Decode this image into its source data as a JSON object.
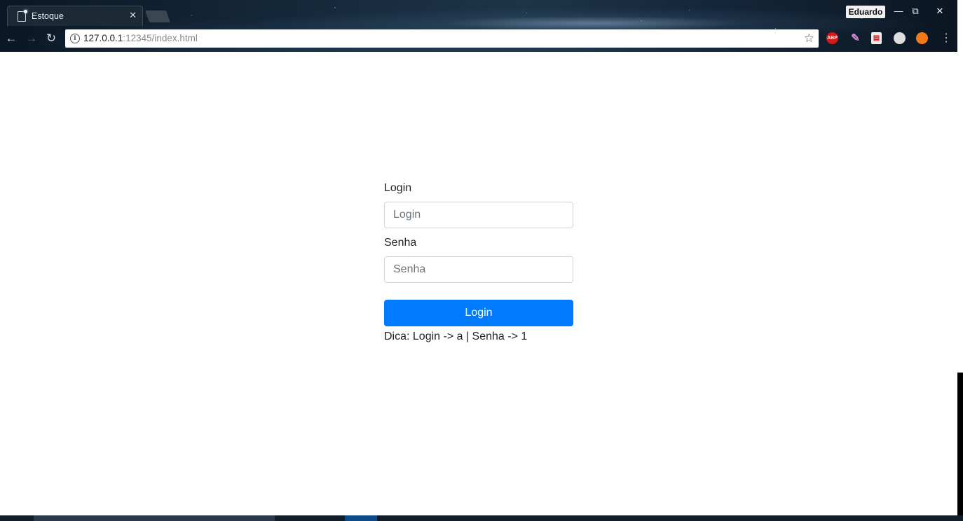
{
  "browser": {
    "tab": {
      "title": "Estoque",
      "close_glyph": "✕"
    },
    "profile_name": "Eduardo",
    "window_controls": {
      "minimize": "—",
      "maximize": "⧉",
      "close": "✕"
    },
    "nav": {
      "back": "←",
      "forward": "→",
      "reload": "↻"
    },
    "address": {
      "host": "127.0.0.1",
      "rest": ":12345/index.html"
    },
    "extensions": {
      "abp_label": "ABP"
    }
  },
  "form": {
    "login_label": "Login",
    "login_placeholder": "Login",
    "password_label": "Senha",
    "password_placeholder": "Senha",
    "submit_label": "Login",
    "hint": "Dica: Login -> a | Senha -> 1"
  },
  "colors": {
    "primary": "#007bff",
    "text": "#212529",
    "input_border": "#ced4da"
  }
}
